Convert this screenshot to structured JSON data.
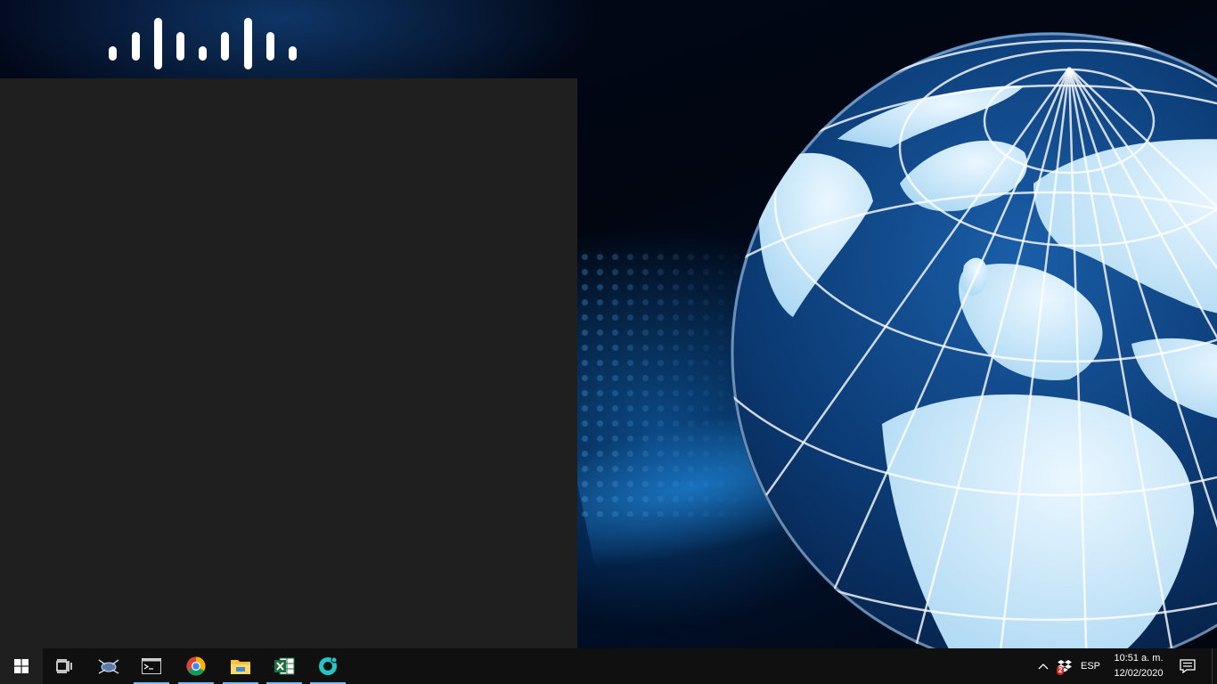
{
  "taskbar": {
    "pinned": [
      {
        "name": "task-view",
        "running": false
      },
      {
        "name": "network-app",
        "running": false
      },
      {
        "name": "command-prompt",
        "running": true
      },
      {
        "name": "chrome",
        "running": true
      },
      {
        "name": "file-explorer",
        "running": true
      },
      {
        "name": "excel",
        "running": true
      },
      {
        "name": "teal-app",
        "running": true
      }
    ],
    "tray": {
      "dropbox_badge": "2",
      "language": "ESP",
      "time": "10:51 a. m.",
      "date": "12/02/2020"
    }
  },
  "icons": {
    "start": "windows-logo-icon",
    "overflow": "chevron-up-icon",
    "notifications": "action-center-icon"
  },
  "colors": {
    "taskbar": "#101010",
    "start_panel": "#1f1f1f",
    "running_indicator": "#76b9ed",
    "globe_ocean": "#0b3a73",
    "globe_land": "#d6eefc"
  }
}
